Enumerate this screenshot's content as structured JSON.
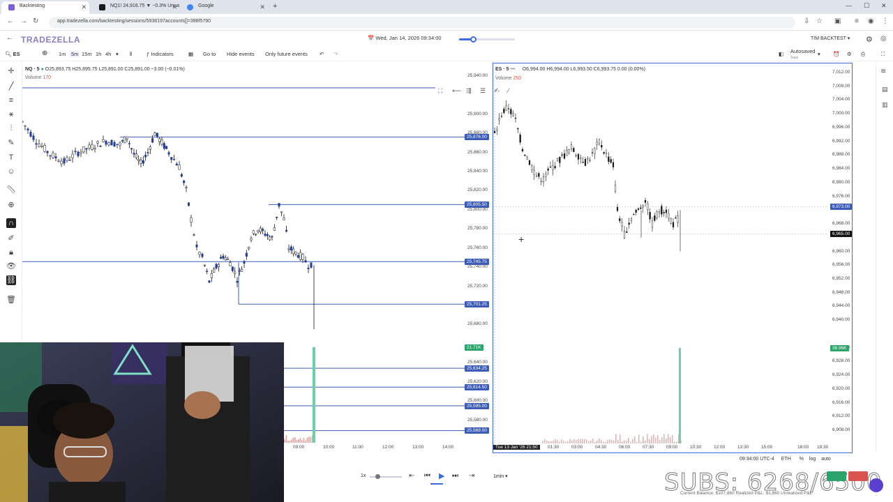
{
  "browser": {
    "tabs": [
      {
        "label": "Backtesting",
        "active": true,
        "color": "#7b61d6"
      },
      {
        "label": "NQ1! 24,916.75 ▼ −0.3% Unna",
        "active": false,
        "color": "#1a1a1a"
      },
      {
        "label": "Google",
        "active": false,
        "color": "#4285f4"
      }
    ],
    "url": "app.tradezella.com/backtesting/sessions/5938197accounts[]=398f5790"
  },
  "header": {
    "logo": "TRADEZELLA",
    "date": "Wed, Jan 14, 2026 09:34:00",
    "replay_progress": 0.25,
    "user": "TIM BACKTEST"
  },
  "toolbar": {
    "symbol": "ES",
    "timeframes": [
      "1m",
      "5m",
      "15m",
      "1h",
      "4h"
    ],
    "active_timeframe": "5m",
    "indicators": "Indicators",
    "goto": "Go to",
    "hide_events": "Hide events",
    "future_events": "Only future events",
    "autosaved": "Autosaved",
    "autosaved_sub": "Save"
  },
  "left_chart": {
    "symbol": "NQ · 5",
    "ohlc": "O25,893.75 H25,895.75 L25,891.00 C25,891.00 −3.00 (−0.01%)",
    "volume_label": "Volume",
    "volume_value": "170",
    "y_ticks": [
      "25,940.00",
      "25,900.00",
      "25,880.00",
      "25,860.00",
      "25,840.00",
      "25,820.00",
      "25,800.00",
      "25,780.00",
      "25,760.00",
      "25,740.00",
      "25,720.00",
      "25,680.00",
      "25,640.00",
      "25,620.00",
      "25,600.00",
      "25,580.00"
    ],
    "x_ticks": [
      "09:00",
      "10:00",
      "11:00",
      "12:00",
      "13:00",
      "14:00"
    ],
    "price_levels": [
      {
        "label": "25,876.00",
        "price": 25876
      },
      {
        "label": "25,805.50",
        "price": 25805.5
      },
      {
        "label": "25,745.75",
        "price": 25745.75
      },
      {
        "label": "25,701.25",
        "price": 25701.25
      },
      {
        "label": "25,634.25",
        "price": 25634.25
      },
      {
        "label": "25,614.50",
        "price": 25614.5
      },
      {
        "label": "25,595.00",
        "price": 25595
      },
      {
        "label": "25,569.00",
        "price": 25569
      }
    ],
    "volume_badge": "21.71K"
  },
  "right_chart": {
    "symbol": "ES · 5",
    "ohlc": "O6,994.00 H6,994.00 L6,993.50 C6,993.75 0.00 (0.00%)",
    "volume_label": "Volume",
    "volume_value": "250",
    "y_ticks": [
      "7,012.00",
      "7,008.00",
      "7,004.00",
      "7,000.00",
      "6,996.00",
      "6,992.00",
      "6,988.00",
      "6,984.00",
      "6,980.00",
      "6,976.00",
      "6,968.00",
      "6,960.00",
      "6,956.00",
      "6,952.00",
      "6,948.00",
      "6,944.00",
      "6,940.00",
      "6,932.00",
      "6,928.00",
      "6,924.00",
      "6,920.00",
      "6,916.00",
      "6,912.00",
      "6,908.00"
    ],
    "x_ticks": [
      "01:30",
      "03:00",
      "04:30",
      "06:00",
      "07:30",
      "09:00",
      "10:30",
      "12:00",
      "13:30",
      "15:00",
      "18:00",
      "19:30"
    ],
    "x_start": "Tue 13 Jan '26  21:50",
    "price_badges": [
      "6,973.00",
      "6,965.00"
    ],
    "volume_badge": "38.96K"
  },
  "status": {
    "time": "09:34:00 UTC-4",
    "session": "ETH",
    "pct": "%",
    "log": "log",
    "auto": "auto"
  },
  "playback": {
    "speed": "1x",
    "interval": "1min"
  },
  "overlay": {
    "subs": "SUBS: 6268/6500",
    "footer": "Current Balance: $107,860   Realized P&L: $1,860   Unrealized P&L"
  },
  "colors": {
    "accent": "#3c6be0",
    "level": "#3c5bb5",
    "volume": "#6ad0a8"
  }
}
